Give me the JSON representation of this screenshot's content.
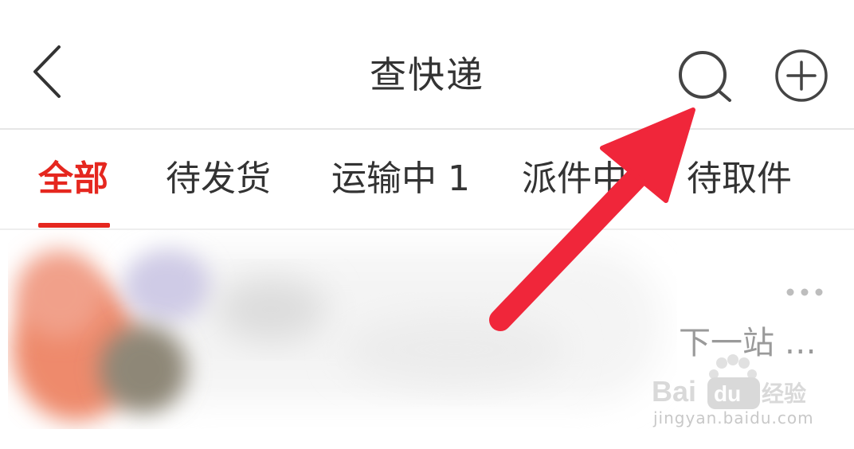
{
  "header": {
    "title": "查快递",
    "back_icon": "chevron-left-icon",
    "search_icon": "search-icon",
    "add_icon": "plus-circle-icon"
  },
  "tabs": [
    {
      "label": "全部",
      "active": true
    },
    {
      "label": "待发货",
      "active": false
    },
    {
      "label": "运输中 1",
      "active": false
    },
    {
      "label": "派件中",
      "active": false
    },
    {
      "label": "待取件",
      "active": false
    }
  ],
  "card": {
    "status_text": "下一站 …",
    "more_icon": "more-dots-icon"
  },
  "watermark": {
    "logo_text": "Bai du 经验",
    "url": "jingyan.baidu.com"
  },
  "colors": {
    "accent": "#e5271f",
    "annotation_arrow": "#f0263a",
    "text_primary": "#333333",
    "text_secondary": "#9a9a9a"
  }
}
